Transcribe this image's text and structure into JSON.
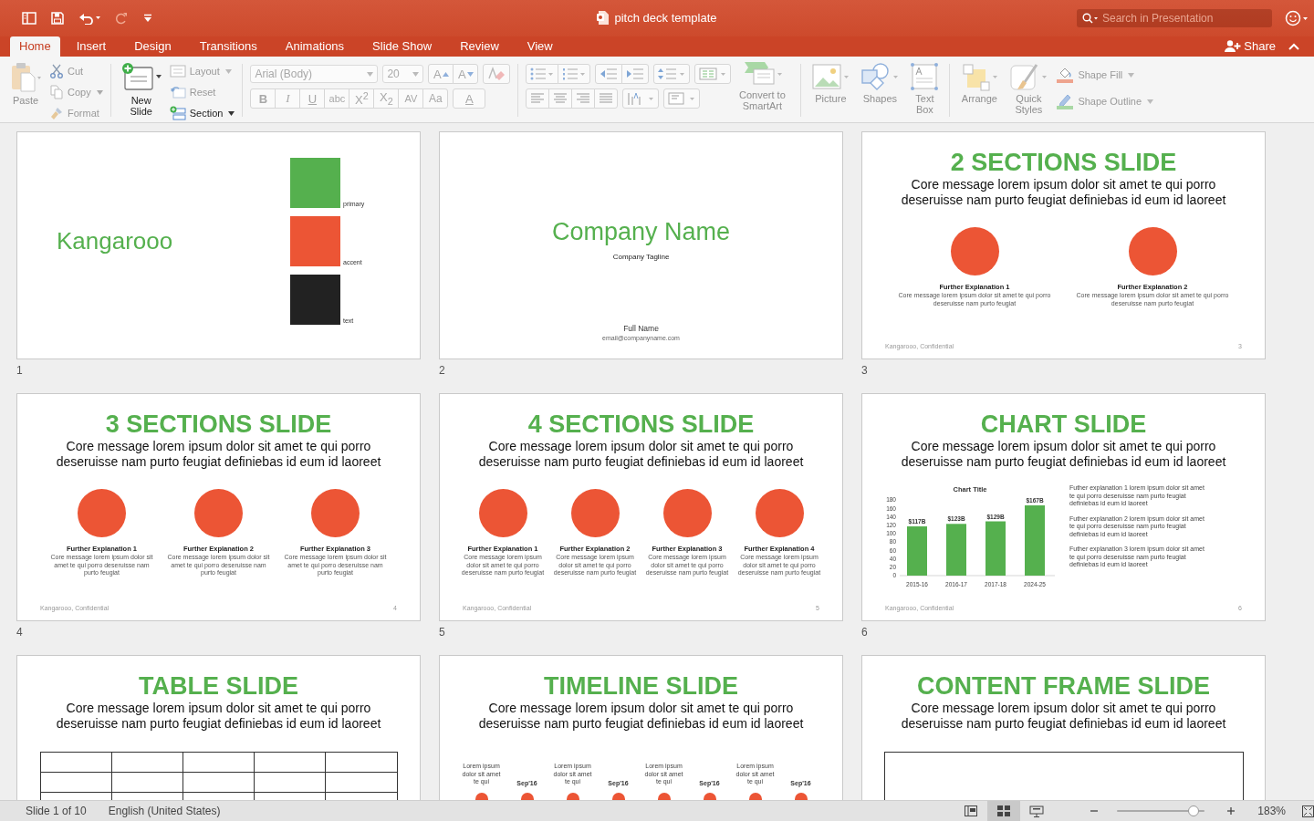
{
  "titlebar": {
    "title": "pitch deck template",
    "search": {
      "placeholder": "Search in Presentation"
    }
  },
  "tabs": [
    {
      "label": "Home",
      "selected": true
    },
    {
      "label": "Insert",
      "selected": false
    },
    {
      "label": "Design",
      "selected": false
    },
    {
      "label": "Transitions",
      "selected": false
    },
    {
      "label": "Animations",
      "selected": false
    },
    {
      "label": "Slide Show",
      "selected": false
    },
    {
      "label": "Review",
      "selected": false
    },
    {
      "label": "View",
      "selected": false
    }
  ],
  "share": "Share",
  "ribbon": {
    "paste": {
      "label": "Paste",
      "disabled": true
    },
    "clipboard": [
      {
        "label": "Cut",
        "kind": "cut",
        "disabled": true
      },
      {
        "label": "Copy",
        "kind": "copy",
        "disabled": true
      },
      {
        "label": "Format",
        "kind": "format",
        "disabled": true
      }
    ],
    "new_slide": {
      "label": "New Slide",
      "disabled": false
    },
    "slide_tools": [
      {
        "label": "Layout",
        "kind": "layout",
        "disabled": true
      },
      {
        "label": "Reset",
        "kind": "reset",
        "disabled": true
      },
      {
        "label": "Section",
        "kind": "section",
        "disabled": false
      }
    ],
    "font": {
      "family": "Arial (Body)",
      "size": "20",
      "disabled": true
    },
    "font_size_buttons": [
      "A",
      "A"
    ],
    "format_buttons": [
      "B",
      "I",
      "U",
      "abc",
      "X$^{2}$",
      "X$_{2}$",
      "AV",
      "Aa"
    ],
    "font_color": "A",
    "smartart": {
      "label": "Convert to SmartArt",
      "disabled": true
    },
    "insert": [
      {
        "label": "Picture",
        "kind": "picture",
        "disabled": true
      },
      {
        "label": "Shapes",
        "kind": "shapes",
        "disabled": true
      },
      {
        "label": "Text Box",
        "kind": "textbox",
        "disabled": true
      }
    ],
    "drawing": [
      {
        "label": "Arrange",
        "kind": "arrange",
        "disabled": true
      },
      {
        "label": "Quick Styles",
        "kind": "styles",
        "disabled": true
      }
    ],
    "shape_format": [
      {
        "label": "Shape Fill",
        "kind": "fill",
        "disabled": true
      },
      {
        "label": "Shape Outline",
        "kind": "outline",
        "disabled": true
      }
    ]
  },
  "slides": [
    {
      "kind": "brand",
      "number": "1",
      "name": "Kangarooo",
      "swatches": [
        {
          "label": "primary",
          "color": "#55b04e"
        },
        {
          "label": "accent",
          "color": "#ec5535"
        },
        {
          "label": "text",
          "color": "#222222"
        }
      ]
    },
    {
      "kind": "cover",
      "number": "2",
      "company": "Company Name",
      "tagline": "Company Tagline",
      "person": "Full Name",
      "email": "email@companyname.com"
    },
    {
      "kind": "sections",
      "number": "3",
      "title": "2 SECTIONS SLIDE",
      "message": "Core message lorem ipsum dolor sit amet te qui porro deseruisse nam purto feugiat definiebas id eum id laoreet",
      "sections": [
        {
          "heading": "Further Explanation 1",
          "text": "Core message lorem ipsum dolor sit amet te qui porro deseruisse nam purto feugiat"
        },
        {
          "heading": "Further Explanation 2",
          "text": "Core message lorem ipsum dolor sit amet te qui porro deseruisse nam purto feugiat"
        }
      ],
      "footer": "Kangarooo, Confidential",
      "page": "3"
    },
    {
      "kind": "sections",
      "number": "4",
      "title": "3 SECTIONS SLIDE",
      "message": "Core message lorem ipsum dolor sit amet te qui porro deseruisse nam purto feugiat definiebas id eum id laoreet",
      "sections": [
        {
          "heading": "Further Explanation 1",
          "text": "Core message lorem ipsum dolor sit amet te qui porro deseruisse nam purto feugiat"
        },
        {
          "heading": "Further Explanation 2",
          "text": "Core message lorem ipsum dolor sit amet te qui porro deseruisse nam purto feugiat"
        },
        {
          "heading": "Further Explanation 3",
          "text": "Core message lorem ipsum dolor sit amet te qui porro deseruisse nam purto feugiat"
        }
      ],
      "footer": "Kangarooo, Confidential",
      "page": "4"
    },
    {
      "kind": "sections",
      "number": "5",
      "title": "4 SECTIONS SLIDE",
      "message": "Core message lorem ipsum dolor sit amet te qui porro deseruisse nam purto feugiat definiebas id eum id laoreet",
      "sections": [
        {
          "heading": "Further Explanation 1",
          "text": "Core message lorem ipsum dolor sit amet te qui porro deseruisse nam purto feugiat"
        },
        {
          "heading": "Further Explanation 2",
          "text": "Core message lorem ipsum dolor sit amet te qui porro deseruisse nam purto feugiat"
        },
        {
          "heading": "Further Explanation 3",
          "text": "Core message lorem ipsum dolor sit amet te qui porro deseruisse nam purto feugiat"
        },
        {
          "heading": "Further Explanation 4",
          "text": "Core message lorem ipsum dolor sit amet te qui porro deseruisse nam purto feugiat"
        }
      ],
      "footer": "Kangarooo, Confidential",
      "page": "5"
    },
    {
      "kind": "chart",
      "number": "6",
      "title": "CHART SLIDE",
      "message": "Core message lorem ipsum dolor sit amet te qui porro deseruisse nam purto feugiat definiebas id eum id laoreet",
      "chart_data": {
        "type": "bar",
        "title": "Chart Title",
        "categories": [
          "2015-16",
          "2016-17",
          "2017-18",
          "2024-25"
        ],
        "series": [
          {
            "color": "#55b04e",
            "values": [
              117,
              123,
              129,
              167
            ]
          }
        ],
        "ylim": [
          0,
          180
        ],
        "yticks": [
          0,
          20,
          40,
          60,
          80,
          100,
          120,
          140,
          160,
          180
        ],
        "value_labels": [
          "$117B",
          "$123B",
          "$129B",
          "$167B"
        ]
      },
      "notes": [
        "Futher explanation 1 lorem ipsum dolor sit amet te qui porro deseruisse nam purto feugiat definiebas id eum id laoreet",
        "Futher explanation 2 lorem ipsum dolor sit amet te qui porro deseruisse nam purto feugiat definiebas id eum id laoreet",
        "Futher explanation 3 lorem ipsum dolor sit amet te qui porro deseruisse nam purto feugiat definiebas id eum id laoreet"
      ],
      "footer": "Kangarooo, Confidential",
      "page": "6"
    },
    {
      "kind": "table",
      "title": "TABLE SLIDE",
      "message": "Core message lorem ipsum dolor sit amet te qui porro deseruisse nam purto feugiat definiebas id eum id laoreet"
    },
    {
      "kind": "timeline",
      "title": "TIMELINE SLIDE",
      "message": "Core message lorem ipsum dolor sit amet te qui porro deseruisse nam purto feugiat definiebas id eum id laoreet",
      "events": [
        {
          "text": "Lorem ipsum dolor sit amet te qui",
          "date": "Sep'16"
        },
        {
          "text": "Lorem ipsum dolor sit amet te qui",
          "date": "Sep'16"
        },
        {
          "text": "Lorem ipsum dolor sit amet te qui",
          "date": "Sep'16"
        },
        {
          "text": "Lorem ipsum dolor sit amet te qui",
          "date": "Sep'16"
        }
      ]
    },
    {
      "kind": "frame",
      "title": "CONTENT FRAME SLIDE",
      "message": "Core message lorem ipsum dolor sit amet te qui porro deseruisse nam purto feugiat definiebas id eum id laoreet"
    }
  ],
  "status_bar": {
    "slide": "Slide 1 of 10",
    "language": "English (United States)",
    "views": [
      {
        "kind": "normal",
        "selected": false
      },
      {
        "kind": "sorter",
        "selected": true
      },
      {
        "kind": "reading",
        "selected": false
      }
    ],
    "zoom": {
      "level": 0.87,
      "reading": "183%"
    }
  }
}
